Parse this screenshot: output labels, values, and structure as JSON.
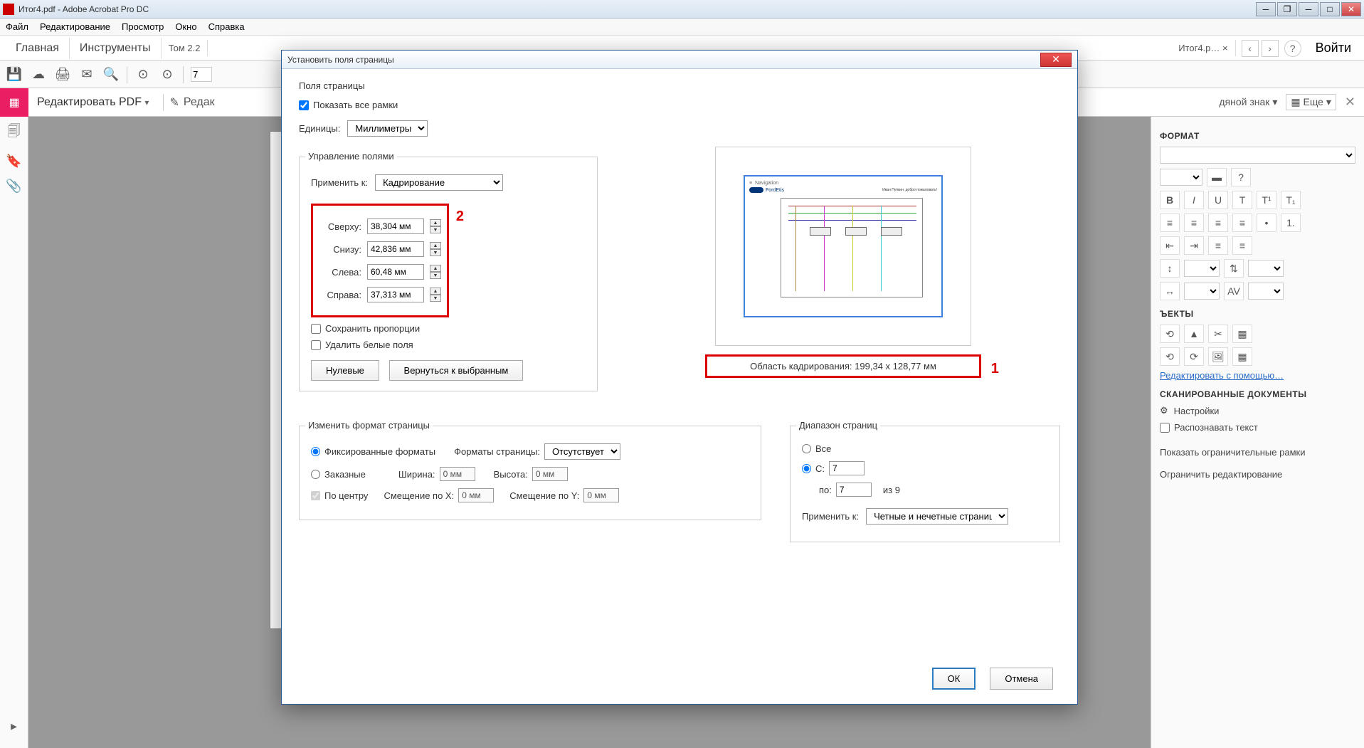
{
  "titlebar": {
    "text": "Итог4.pdf - Adobe Acrobat Pro DC"
  },
  "menubar": {
    "file": "Файл",
    "edit": "Редактирование",
    "view": "Просмотр",
    "window": "Окно",
    "help": "Справка"
  },
  "toptabs": {
    "home": "Главная",
    "tools": "Инструменты",
    "tab1": "Том 2.2",
    "activetab": "Итог4.p…",
    "login": "Войти"
  },
  "editbar": {
    "title": "Редактировать PDF",
    "edit_action": "Редак",
    "watermark": "дяной знак",
    "more": "Еще"
  },
  "rightpanel": {
    "format": "ФОРМАТ",
    "objects": "ЪЕКТЫ",
    "edit_with": "Редактировать с помощью…",
    "scanned": "СКАНИРОВАННЫЕ ДОКУМЕНТЫ",
    "settings": "Настройки",
    "ocr": "Распознавать текст",
    "show_frames": "Показать ограничительные рамки",
    "restrict": "Ограничить редактирование"
  },
  "docpage": {
    "nav": "Navigation",
    "brand": "Fo"
  },
  "dialog": {
    "title": "Установить поля страницы",
    "fields_section": "Поля страницы",
    "show_all_frames": "Показать все рамки",
    "units_label": "Единицы:",
    "units_value": "Миллиметры",
    "manage_fields": "Управление полями",
    "apply_to": "Применить к:",
    "apply_to_value": "Кадрирование",
    "top_label": "Сверху:",
    "top_value": "38,304 мм",
    "bottom_label": "Снизу:",
    "bottom_value": "42,836 мм",
    "left_label": "Слева:",
    "left_value": "60,48 мм",
    "right_label": "Справа:",
    "right_value": "37,313 мм",
    "keep_ratio": "Сохранить пропорции",
    "remove_white": "Удалить белые поля",
    "btn_zero": "Нулевые",
    "btn_revert": "Вернуться к выбранным",
    "crop_area": "Область кадрирования: 199,34 x 128,77 мм",
    "annotation_1": "1",
    "annotation_2": "2",
    "change_format": "Изменить формат страницы",
    "fixed_formats": "Фиксированные форматы",
    "page_formats": "Форматы страницы:",
    "page_formats_value": "Отсутствует",
    "custom": "Заказные",
    "width": "Ширина:",
    "width_value": "0 мм",
    "height": "Высота:",
    "height_value": "0 мм",
    "centered": "По центру",
    "offset_x": "Смещение по X:",
    "offset_x_value": "0 мм",
    "offset_y": "Смещение по Y:",
    "offset_y_value": "0 мм",
    "page_range": "Диапазон страниц",
    "all": "Все",
    "from": "С:",
    "from_value": "7",
    "to": "по:",
    "to_value": "7",
    "of": "из 9",
    "apply_to2": "Применить к:",
    "apply_to2_value": "Четные и нечетные страницы",
    "ok": "ОК",
    "cancel": "Отмена"
  },
  "preview": {
    "nav": "Navigation",
    "brand": "FordEtis",
    "welcome": "Иван Пупкин, добро пожаловать!"
  }
}
